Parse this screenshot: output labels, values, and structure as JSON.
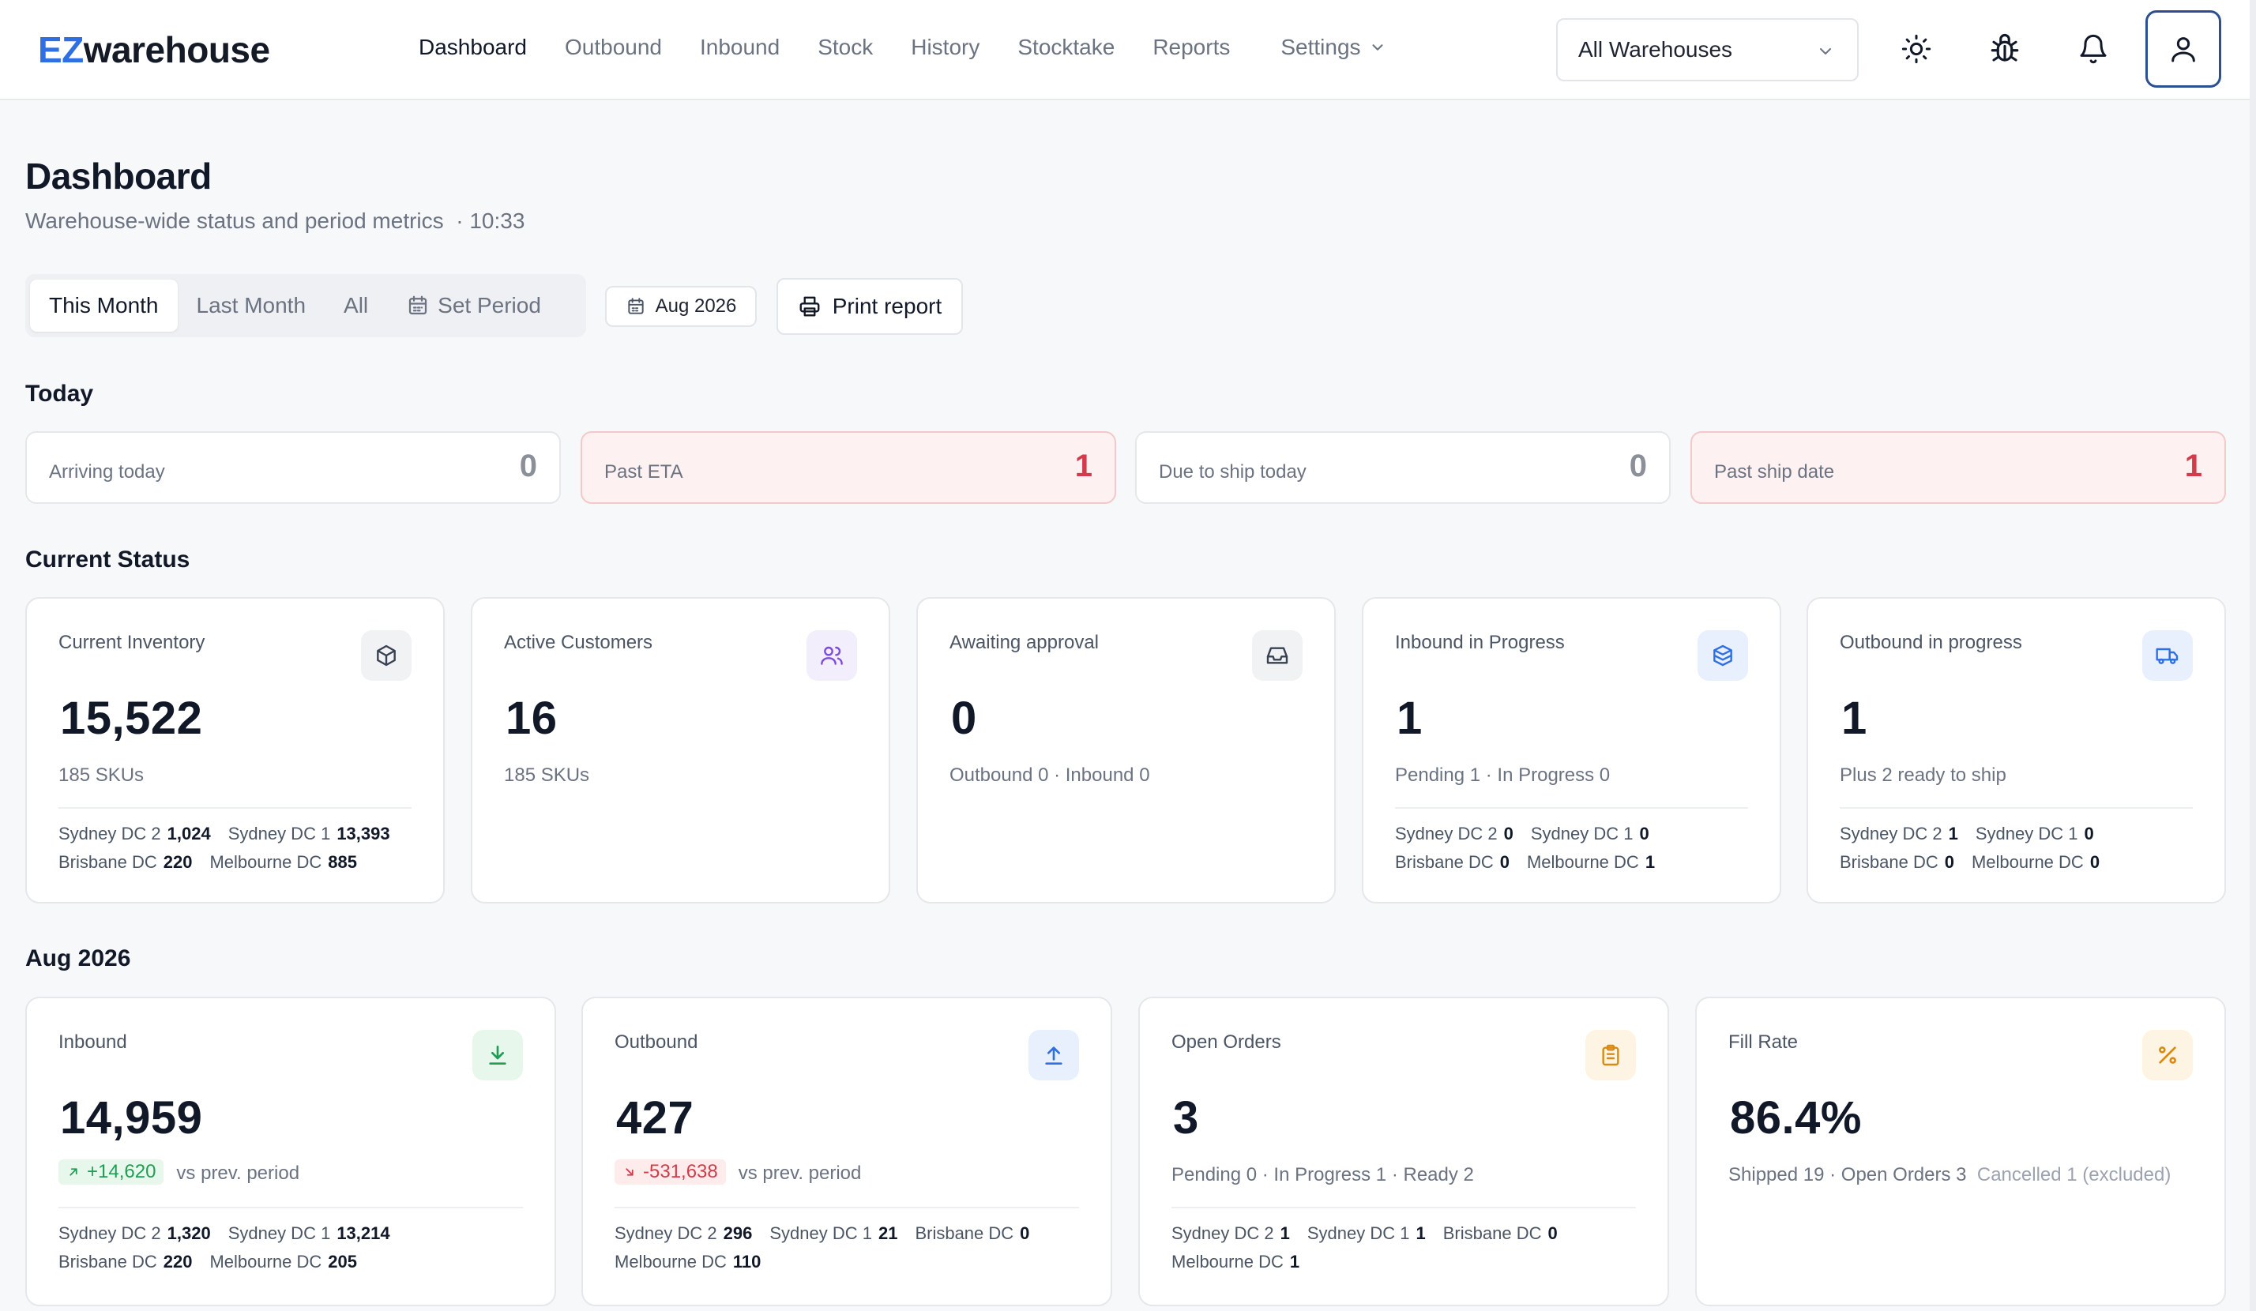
{
  "app": {
    "logo_prefix": "EZ",
    "logo_suffix": "warehouse",
    "nav": [
      {
        "label": "Dashboard"
      },
      {
        "label": "Outbound"
      },
      {
        "label": "Inbound"
      },
      {
        "label": "Stock"
      },
      {
        "label": "History"
      },
      {
        "label": "Stocktake"
      },
      {
        "label": "Reports"
      },
      {
        "label": "Settings"
      }
    ],
    "warehouse_select": "All Warehouses"
  },
  "header": {
    "title": "Dashboard",
    "subtitle": "Warehouse-wide status and period metrics",
    "time": "· 10:33"
  },
  "period": {
    "options": [
      "This Month",
      "Last Month",
      "All",
      "Set Period"
    ],
    "selected": "This Month",
    "current": "Aug 2026",
    "print_label": "Print report"
  },
  "today": {
    "title": "Today",
    "cards": [
      {
        "label": "Arriving today",
        "value": "0"
      },
      {
        "label": "Past ETA",
        "value": "1"
      },
      {
        "label": "Due to ship today",
        "value": "0"
      },
      {
        "label": "Past ship date",
        "value": "1"
      }
    ]
  },
  "status": {
    "title": "Current Status",
    "cards": [
      {
        "label": "Current Inventory",
        "value": "15,522",
        "sub": "185 SKUs",
        "icon": "box-icon",
        "breakdown": [
          [
            {
              "name": "Sydney DC 2",
              "v": "1,024"
            },
            {
              "name": "Sydney DC 1",
              "v": "13,393"
            }
          ],
          [
            {
              "name": "Brisbane DC",
              "v": "220"
            },
            {
              "name": "Melbourne DC",
              "v": "885"
            }
          ]
        ]
      },
      {
        "label": "Active Customers",
        "value": "16",
        "sub": "185 SKUs",
        "icon": "users-icon"
      },
      {
        "label": "Awaiting approval",
        "value": "0",
        "sub": "Outbound 0 · Inbound 0",
        "icon": "inbox-icon"
      },
      {
        "label": "Inbound in Progress",
        "value": "1",
        "sub": "Pending 1 · In Progress 0",
        "icon": "boxes-icon",
        "breakdown": [
          [
            {
              "name": "Sydney DC 2",
              "v": "0"
            },
            {
              "name": "Sydney DC 1",
              "v": "0"
            }
          ],
          [
            {
              "name": "Brisbane DC",
              "v": "0"
            },
            {
              "name": "Melbourne DC",
              "v": "1"
            }
          ]
        ]
      },
      {
        "label": "Outbound in progress",
        "value": "1",
        "sub": "Plus 2 ready to ship",
        "icon": "truck-icon",
        "breakdown": [
          [
            {
              "name": "Sydney DC 2",
              "v": "1"
            },
            {
              "name": "Sydney DC 1",
              "v": "0"
            }
          ],
          [
            {
              "name": "Brisbane DC",
              "v": "0"
            },
            {
              "name": "Melbourne DC",
              "v": "0"
            }
          ]
        ]
      }
    ]
  },
  "period_metrics": {
    "title": "Aug 2026",
    "cards": [
      {
        "label": "Inbound",
        "value": "14,959",
        "delta": "+14,620",
        "delta_dir": "up",
        "delta_suffix": "vs prev. period",
        "icon": "download-icon",
        "breakdown": [
          [
            {
              "name": "Sydney DC 2",
              "v": "1,320"
            },
            {
              "name": "Sydney DC 1",
              "v": "13,214"
            }
          ],
          [
            {
              "name": "Brisbane DC",
              "v": "220"
            },
            {
              "name": "Melbourne DC",
              "v": "205"
            }
          ]
        ]
      },
      {
        "label": "Outbound",
        "value": "427",
        "delta": "-531,638",
        "delta_dir": "down",
        "delta_suffix": "vs prev. period",
        "icon": "upload-icon",
        "breakdown": [
          [
            {
              "name": "Sydney DC 2",
              "v": "296"
            },
            {
              "name": "Sydney DC 1",
              "v": "21"
            },
            {
              "name": "Brisbane DC",
              "v": "0"
            }
          ],
          [
            {
              "name": "Melbourne DC",
              "v": "110"
            }
          ]
        ]
      },
      {
        "label": "Open Orders",
        "value": "3",
        "sub": "Pending 0 · In Progress 1 · Ready 2",
        "icon": "clipboard-icon",
        "breakdown": [
          [
            {
              "name": "Sydney DC 2",
              "v": "1"
            },
            {
              "name": "Sydney DC 1",
              "v": "1"
            },
            {
              "name": "Brisbane DC",
              "v": "0"
            }
          ],
          [
            {
              "name": "Melbourne DC",
              "v": "1"
            }
          ]
        ]
      },
      {
        "label": "Fill Rate",
        "value": "86.4%",
        "sub": "Shipped 19 · Open Orders 3",
        "sub_muted": "Cancelled 1 (excluded)",
        "icon": "percent-icon"
      }
    ]
  },
  "colors": {
    "accent": "#2f6fe4",
    "danger": "#d33a4a",
    "success": "#1f9d55"
  }
}
